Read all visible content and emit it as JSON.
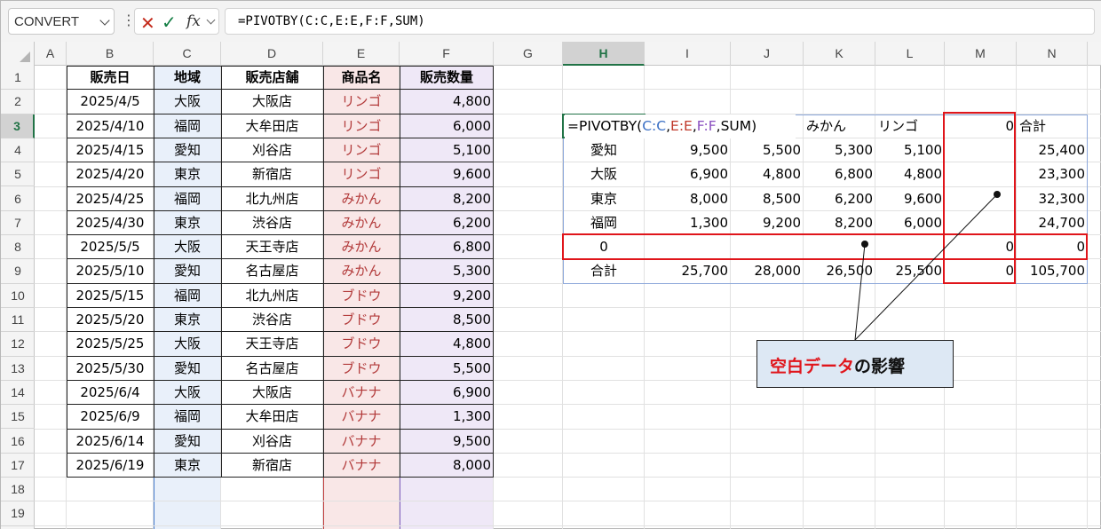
{
  "name_box": "CONVERT",
  "formula": "=PIVOTBY(C:C,E:E,F:F,SUM)",
  "formula_bar_icons": {
    "cancel": "✕",
    "enter": "✓",
    "function": "fx"
  },
  "columns": [
    "A",
    "B",
    "C",
    "D",
    "E",
    "F",
    "G",
    "H",
    "I",
    "J",
    "K",
    "L",
    "M",
    "N"
  ],
  "rows": [
    "1",
    "2",
    "3",
    "4",
    "5",
    "6",
    "7",
    "8",
    "9",
    "10",
    "11",
    "12",
    "13",
    "14",
    "15",
    "16",
    "17",
    "18",
    "19"
  ],
  "headers": {
    "date": "販売日",
    "region": "地域",
    "store": "販売店舗",
    "product": "商品名",
    "qty": "販売数量"
  },
  "records": [
    [
      "2025/4/5",
      "大阪",
      "大阪店",
      "リンゴ",
      "4,800"
    ],
    [
      "2025/4/10",
      "福岡",
      "大牟田店",
      "リンゴ",
      "6,000"
    ],
    [
      "2025/4/15",
      "愛知",
      "刈谷店",
      "リンゴ",
      "5,100"
    ],
    [
      "2025/4/20",
      "東京",
      "新宿店",
      "リンゴ",
      "9,600"
    ],
    [
      "2025/4/25",
      "福岡",
      "北九州店",
      "みかん",
      "8,200"
    ],
    [
      "2025/4/30",
      "東京",
      "渋谷店",
      "みかん",
      "6,200"
    ],
    [
      "2025/5/5",
      "大阪",
      "天王寺店",
      "みかん",
      "6,800"
    ],
    [
      "2025/5/10",
      "愛知",
      "名古屋店",
      "みかん",
      "5,300"
    ],
    [
      "2025/5/15",
      "福岡",
      "北九州店",
      "ブドウ",
      "9,200"
    ],
    [
      "2025/5/20",
      "東京",
      "渋谷店",
      "ブドウ",
      "8,500"
    ],
    [
      "2025/5/25",
      "大阪",
      "天王寺店",
      "ブドウ",
      "4,800"
    ],
    [
      "2025/5/30",
      "愛知",
      "名古屋店",
      "ブドウ",
      "5,500"
    ],
    [
      "2025/6/4",
      "大阪",
      "大阪店",
      "バナナ",
      "6,900"
    ],
    [
      "2025/6/9",
      "福岡",
      "大牟田店",
      "バナナ",
      "1,300"
    ],
    [
      "2025/6/14",
      "愛知",
      "刈谷店",
      "バナナ",
      "9,500"
    ],
    [
      "2025/6/19",
      "東京",
      "新宿店",
      "バナナ",
      "8,000"
    ]
  ],
  "pivot": {
    "formula_prefix": "=PIVOTBY(",
    "formula_c": "C:C",
    "comma1": ",",
    "formula_e": "E:E",
    "comma2": ",",
    "formula_f": "F:F",
    "formula_suffix": ",SUM)",
    "col_headers": [
      "みかん",
      "リンゴ",
      "0",
      "合計"
    ],
    "rows": [
      [
        "愛知",
        "9,500",
        "5,500",
        "5,300",
        "5,100",
        "",
        "25,400"
      ],
      [
        "大阪",
        "6,900",
        "4,800",
        "6,800",
        "4,800",
        "",
        "23,300"
      ],
      [
        "東京",
        "8,000",
        "8,500",
        "6,200",
        "9,600",
        "",
        "32,300"
      ],
      [
        "福岡",
        "1,300",
        "9,200",
        "8,200",
        "6,000",
        "",
        "24,700"
      ],
      [
        "0",
        "",
        "",
        "",
        "",
        "0",
        "0"
      ],
      [
        "合計",
        "25,700",
        "28,000",
        "26,500",
        "25,500",
        "0",
        "105,700"
      ]
    ]
  },
  "callout": {
    "red_text": "空白データ",
    "black_text": "の影響"
  },
  "colors": {
    "accent_green": "#217346",
    "highlight_red": "#e0151b",
    "region_band": "#e9f0fa",
    "product_band": "#f9e7e7",
    "qty_band": "#efe8f7"
  }
}
